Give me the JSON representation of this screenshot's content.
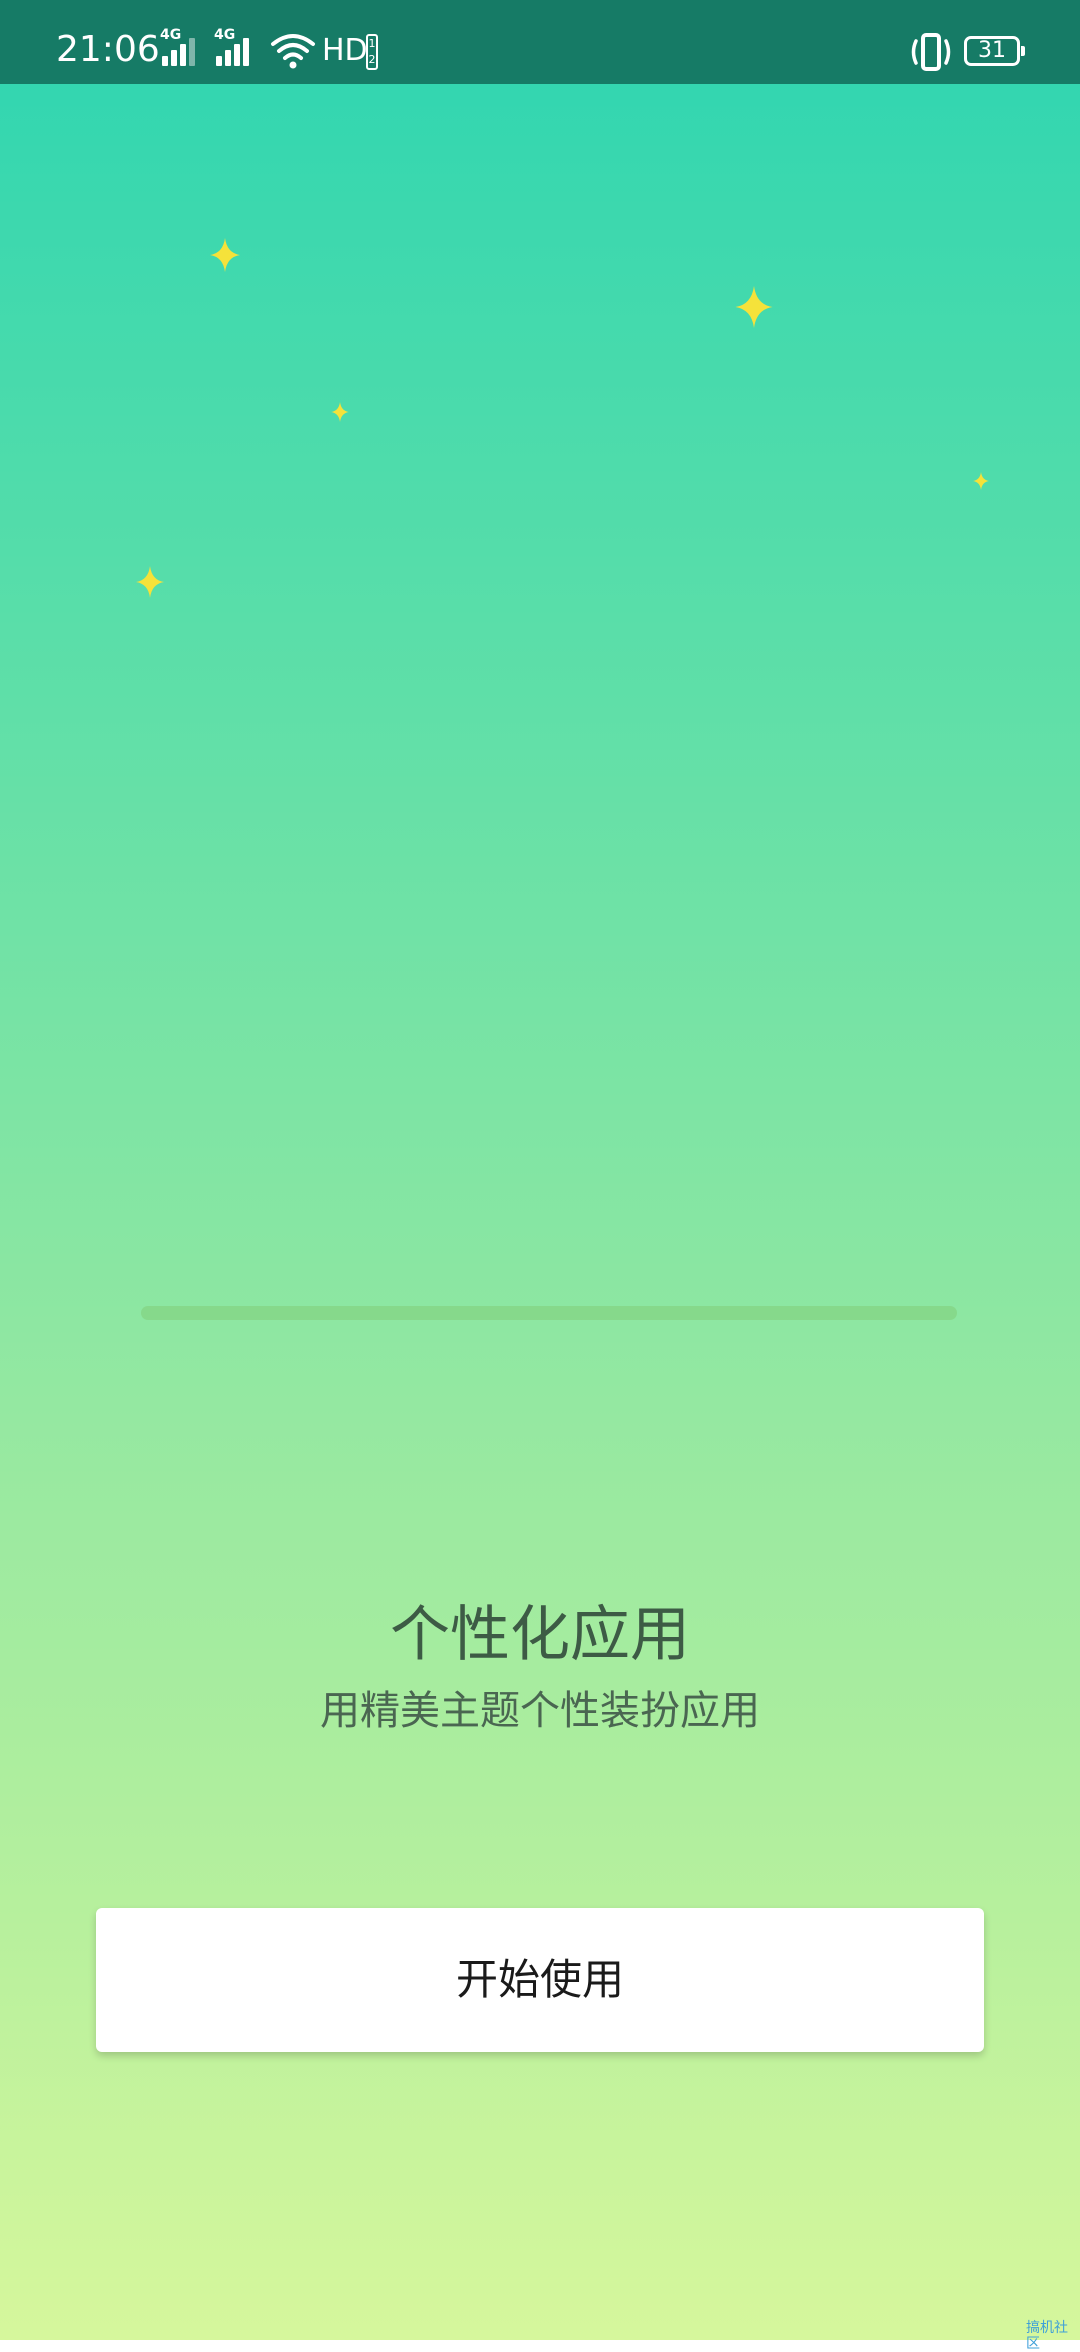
{
  "status_bar": {
    "time": "21:06",
    "network_1": "4G",
    "network_2": "4G",
    "hd_label": "HD",
    "hd_sub": "1 2",
    "battery_level": "31",
    "icons": [
      "signal-icon",
      "wifi-icon",
      "vibrate-icon",
      "battery-icon"
    ]
  },
  "onboarding": {
    "title": "个性化应用",
    "subtitle": "用精美主题个性装扮应用",
    "button_label": "开始使用",
    "progress": 0
  },
  "watermark": "搞机社区",
  "colors": {
    "status_bar": "#167b66",
    "gradient_top": "#2dd5b1",
    "gradient_bottom": "#d6f79c",
    "sparkle": "#f5e23a",
    "title_text": "#3d5b45",
    "button_bg": "#ffffff"
  }
}
